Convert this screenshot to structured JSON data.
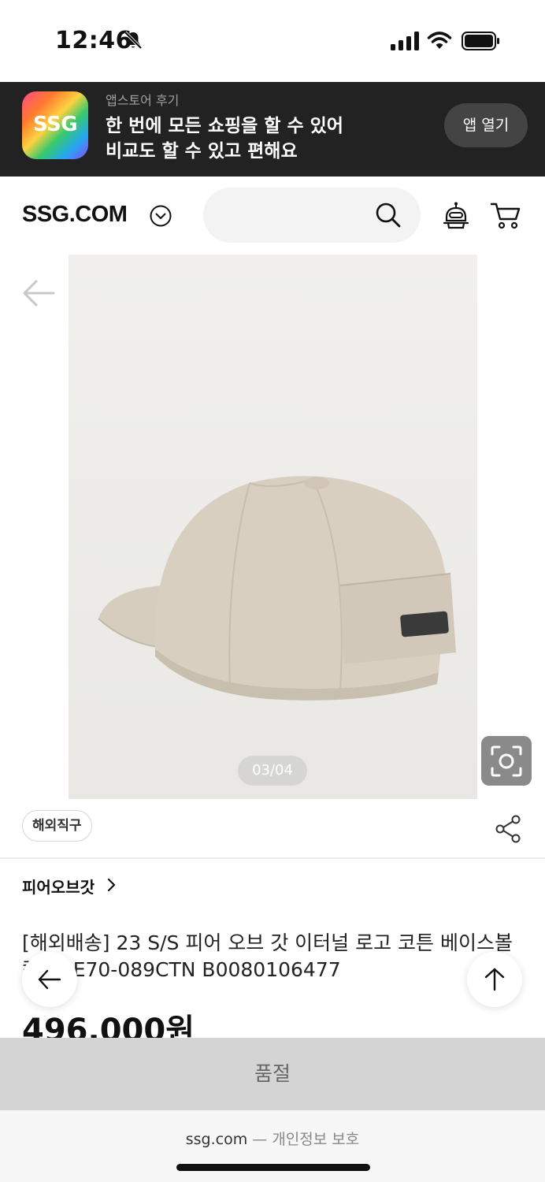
{
  "status_bar": {
    "time": "12:46"
  },
  "app_banner": {
    "logo_text": "SSG",
    "subtitle": "앱스토어 후기",
    "line1": "한 번에 모든 쇼핑을 할 수 있어",
    "line2": "비교도 할 수 있고 편해요",
    "open_button": "앱 열기"
  },
  "header": {
    "brand": "SSG.COM",
    "search_placeholder": ""
  },
  "gallery": {
    "page_indicator": "03/04"
  },
  "product": {
    "tag": "해외직구",
    "brand_link": "피어오브갓",
    "title": "[해외배송] 23 S/S 피어 오브 갓 이터널 로고 코튼 베이스볼 캡 FGE70-089CTN B0080106477",
    "price": "496,000원"
  },
  "actions": {
    "soldout": "품절"
  },
  "browser_bar": {
    "domain": "ssg.com",
    "separator": " — ",
    "privacy": "개인정보 보호"
  },
  "colors": {
    "banner_bg": "#222222",
    "soldout_bg": "#d4d4d4",
    "accent_text": "#111111"
  }
}
